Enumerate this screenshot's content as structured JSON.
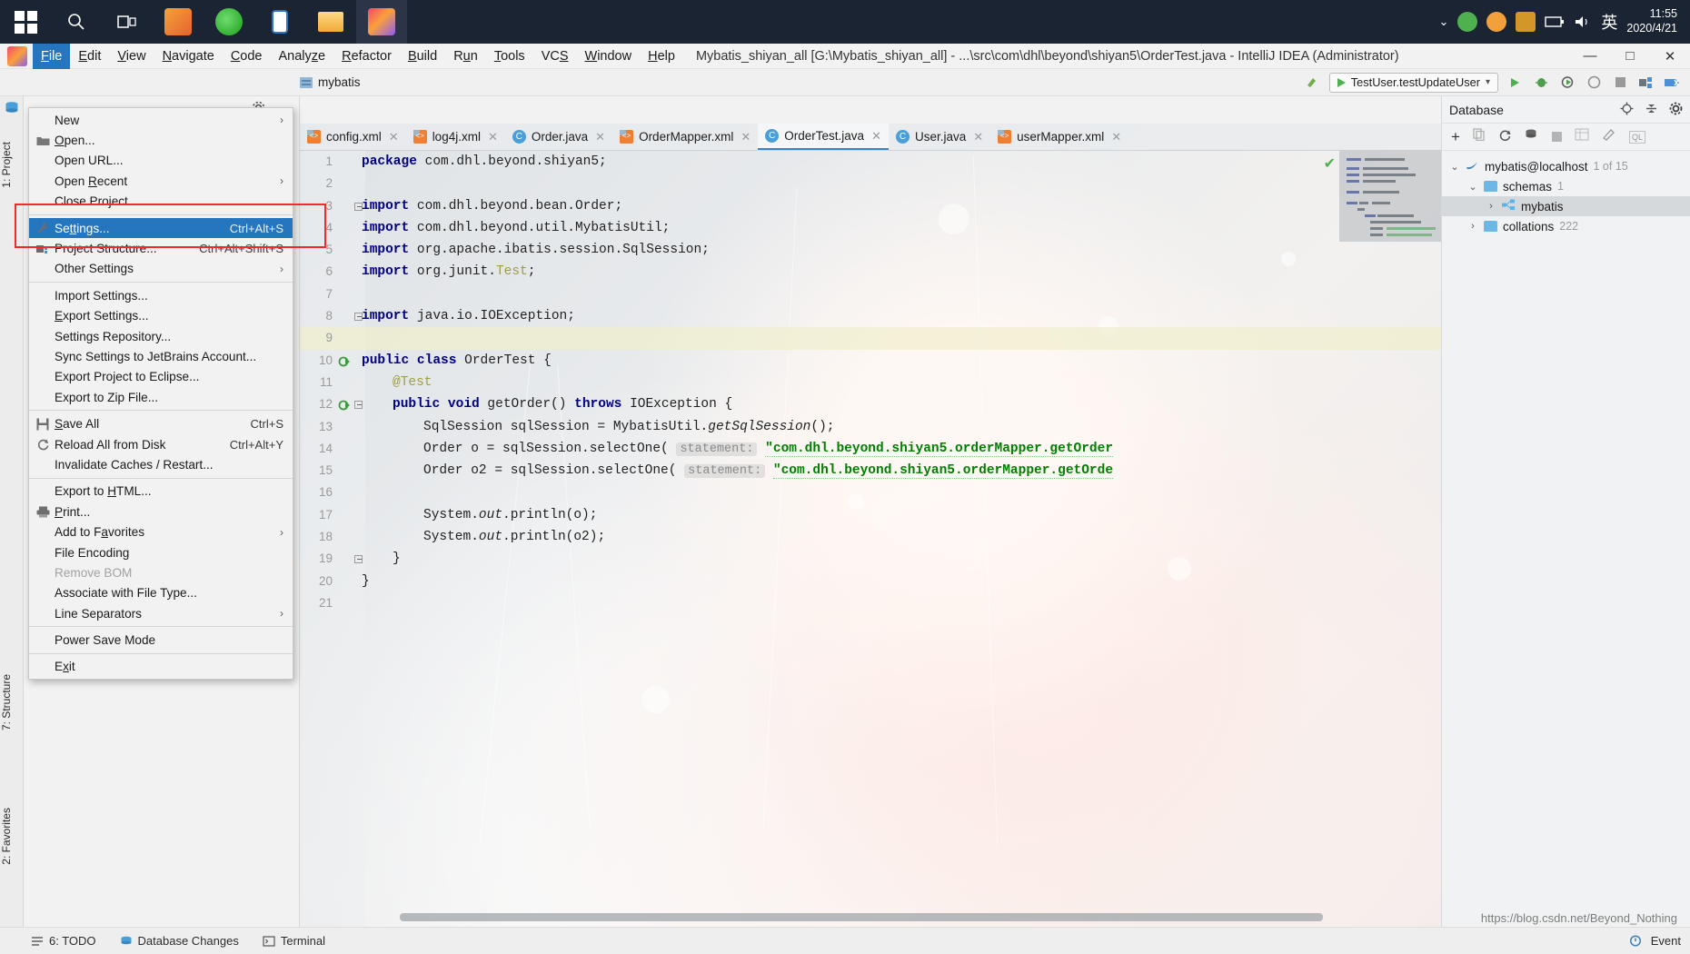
{
  "taskbar": {
    "start_icon": "windows-start-icon",
    "items": [
      {
        "name": "search-icon",
        "glyph": "search"
      },
      {
        "name": "task-view-icon",
        "glyph": "taskview"
      },
      {
        "name": "app-paint-icon",
        "glyph": "paint"
      },
      {
        "name": "app-browser-icon",
        "glyph": "browser"
      },
      {
        "name": "app-phone-icon",
        "glyph": "phone"
      },
      {
        "name": "app-explorer-icon",
        "glyph": "explorer"
      },
      {
        "name": "app-intellij-icon",
        "glyph": "intellij"
      }
    ],
    "tray": {
      "chevron": "⌄",
      "ime_label": "英",
      "time": "11:55",
      "date": "2020/4/21"
    }
  },
  "menubar": {
    "logo": "intellij-idea-logo",
    "items": [
      {
        "label": "File",
        "accel": "F",
        "selected": true
      },
      {
        "label": "Edit",
        "accel": "E",
        "selected": false
      },
      {
        "label": "View",
        "accel": "V",
        "selected": false
      },
      {
        "label": "Navigate",
        "accel": "N",
        "selected": false
      },
      {
        "label": "Code",
        "accel": "C",
        "selected": false
      },
      {
        "label": "Analyze",
        "accel": "z",
        "selected": false
      },
      {
        "label": "Refactor",
        "accel": "R",
        "selected": false
      },
      {
        "label": "Build",
        "accel": "B",
        "selected": false
      },
      {
        "label": "Run",
        "accel": "u",
        "selected": false
      },
      {
        "label": "Tools",
        "accel": "T",
        "selected": false
      },
      {
        "label": "VCS",
        "accel": "S",
        "selected": false
      },
      {
        "label": "Window",
        "accel": "W",
        "selected": false
      },
      {
        "label": "Help",
        "accel": "H",
        "selected": false
      }
    ],
    "window_title": "Mybatis_shiyan_all [G:\\Mybatis_shiyan_all] - ...\\src\\com\\dhl\\beyond\\shiyan5\\OrderTest.java - IntelliJ IDEA (Administrator)",
    "minimize": "—",
    "maximize": "□",
    "close": "✕"
  },
  "file_menu": {
    "groups": [
      [
        {
          "label": "New",
          "key": "",
          "icon": "",
          "arrow": true,
          "state": "normal"
        },
        {
          "label": "Open...",
          "key": "",
          "icon": "folder-icon",
          "arrow": false,
          "state": "normal",
          "accel": "O"
        },
        {
          "label": "Open URL...",
          "key": "",
          "icon": "",
          "arrow": false,
          "state": "normal"
        },
        {
          "label": "Open Recent",
          "key": "",
          "icon": "",
          "arrow": true,
          "state": "normal",
          "accel": "R"
        },
        {
          "label": "Close Project",
          "key": "",
          "icon": "",
          "arrow": false,
          "state": "normal"
        }
      ],
      [
        {
          "label": "Settings...",
          "key": "Ctrl+Alt+S",
          "icon": "wrench-icon",
          "arrow": false,
          "state": "selected",
          "accel": "tt"
        },
        {
          "label": "Project Structure...",
          "key": "Ctrl+Alt+Shift+S",
          "icon": "project-structure-icon",
          "arrow": false,
          "state": "normal"
        },
        {
          "label": "Other Settings",
          "key": "",
          "icon": "",
          "arrow": true,
          "state": "normal"
        }
      ],
      [
        {
          "label": "Import Settings...",
          "key": "",
          "icon": "",
          "arrow": false,
          "state": "normal"
        },
        {
          "label": "Export Settings...",
          "key": "",
          "icon": "",
          "arrow": false,
          "state": "normal",
          "accel": "E"
        },
        {
          "label": "Settings Repository...",
          "key": "",
          "icon": "",
          "arrow": false,
          "state": "normal"
        },
        {
          "label": "Sync Settings to JetBrains Account...",
          "key": "",
          "icon": "",
          "arrow": false,
          "state": "normal"
        },
        {
          "label": "Export Project to Eclipse...",
          "key": "",
          "icon": "",
          "arrow": false,
          "state": "normal"
        },
        {
          "label": "Export to Zip File...",
          "key": "",
          "icon": "",
          "arrow": false,
          "state": "normal"
        }
      ],
      [
        {
          "label": "Save All",
          "key": "Ctrl+S",
          "icon": "save-icon",
          "arrow": false,
          "state": "normal",
          "accel": "S"
        },
        {
          "label": "Reload All from Disk",
          "key": "Ctrl+Alt+Y",
          "icon": "reload-icon",
          "arrow": false,
          "state": "normal"
        },
        {
          "label": "Invalidate Caches / Restart...",
          "key": "",
          "icon": "",
          "arrow": false,
          "state": "normal"
        }
      ],
      [
        {
          "label": "Export to HTML...",
          "key": "",
          "icon": "",
          "arrow": false,
          "state": "normal",
          "accel": "H"
        },
        {
          "label": "Print...",
          "key": "",
          "icon": "printer-icon",
          "arrow": false,
          "state": "normal",
          "accel": "P"
        },
        {
          "label": "Add to Favorites",
          "key": "",
          "icon": "",
          "arrow": true,
          "state": "normal",
          "accel": "a"
        },
        {
          "label": "File Encoding",
          "key": "",
          "icon": "",
          "arrow": false,
          "state": "normal"
        },
        {
          "label": "Remove BOM",
          "key": "",
          "icon": "",
          "arrow": false,
          "state": "disabled"
        },
        {
          "label": "Associate with File Type...",
          "key": "",
          "icon": "",
          "arrow": false,
          "state": "normal"
        },
        {
          "label": "Line Separators",
          "key": "",
          "icon": "",
          "arrow": true,
          "state": "normal"
        }
      ],
      [
        {
          "label": "Power Save Mode",
          "key": "",
          "icon": "",
          "arrow": false,
          "state": "normal"
        }
      ],
      [
        {
          "label": "Exit",
          "key": "",
          "icon": "",
          "arrow": false,
          "state": "normal",
          "accel": "x"
        }
      ]
    ]
  },
  "navbar": {
    "breadcrumb": "mybatis",
    "run_config": "TestUser.testUpdateUser",
    "icons": [
      "run-icon",
      "debug-icon",
      "coverage-icon",
      "profile-icon",
      "stop-icon",
      "build-icon",
      "search-everywhere-icon"
    ]
  },
  "left_strip": {
    "tabs": [
      "1: Project",
      "7: Structure",
      "2: Favorites"
    ],
    "database_icon": "database-icon"
  },
  "editor": {
    "tabs": [
      {
        "label": "config.xml",
        "icon": "xml-file-icon",
        "active": false
      },
      {
        "label": "log4j.xml",
        "icon": "xml-file-icon",
        "active": false
      },
      {
        "label": "Order.java",
        "icon": "java-class-icon",
        "active": false
      },
      {
        "label": "OrderMapper.xml",
        "icon": "xml-file-icon",
        "active": false
      },
      {
        "label": "OrderTest.java",
        "icon": "java-test-icon",
        "active": true
      },
      {
        "label": "User.java",
        "icon": "java-class-icon",
        "active": false
      },
      {
        "label": "userMapper.xml",
        "icon": "xml-file-icon",
        "active": false
      }
    ],
    "close_glyph": "✕",
    "lines": [
      {
        "n": "1",
        "segments": [
          {
            "t": "package ",
            "c": "kw"
          },
          {
            "t": "com.dhl.beyond.shiyan5;",
            "c": ""
          }
        ],
        "indent": 0
      },
      {
        "n": "2",
        "segments": [],
        "indent": 0
      },
      {
        "n": "3",
        "segments": [
          {
            "t": "import ",
            "c": "kw"
          },
          {
            "t": "com.dhl.beyond.bean.Order;",
            "c": ""
          }
        ],
        "indent": 0,
        "fold": true
      },
      {
        "n": "4",
        "segments": [
          {
            "t": "import ",
            "c": "kw"
          },
          {
            "t": "com.dhl.beyond.util.MybatisUtil;",
            "c": ""
          }
        ],
        "indent": 0
      },
      {
        "n": "5",
        "segments": [
          {
            "t": "import ",
            "c": "kw"
          },
          {
            "t": "org.apache.ibatis.session.SqlSession;",
            "c": ""
          }
        ],
        "indent": 0
      },
      {
        "n": "6",
        "segments": [
          {
            "t": "import ",
            "c": "kw"
          },
          {
            "t": "org.junit.",
            "c": ""
          },
          {
            "t": "Test",
            "c": "ann"
          },
          {
            "t": ";",
            "c": ""
          }
        ],
        "indent": 0
      },
      {
        "n": "7",
        "segments": [],
        "indent": 0
      },
      {
        "n": "8",
        "segments": [
          {
            "t": "import ",
            "c": "kw"
          },
          {
            "t": "java.io.IOException;",
            "c": ""
          }
        ],
        "indent": 0,
        "fold": true
      },
      {
        "n": "9",
        "segments": [],
        "indent": 0,
        "highlight": true
      },
      {
        "n": "10",
        "segments": [
          {
            "t": "public class ",
            "c": "kw"
          },
          {
            "t": "OrderTest {",
            "c": ""
          }
        ],
        "indent": 0,
        "run": true
      },
      {
        "n": "11",
        "segments": [
          {
            "t": "@Test",
            "c": "ann"
          }
        ],
        "indent": 1
      },
      {
        "n": "12",
        "segments": [
          {
            "t": "public void ",
            "c": "kw"
          },
          {
            "t": "getOrder() ",
            "c": ""
          },
          {
            "t": "throws ",
            "c": "kw"
          },
          {
            "t": "IOException {",
            "c": ""
          }
        ],
        "indent": 1,
        "run": true,
        "fold": true
      },
      {
        "n": "13",
        "segments": [
          {
            "t": "SqlSession sqlSession = MybatisUtil.",
            "c": ""
          },
          {
            "t": "getSqlSession",
            "c": "itl"
          },
          {
            "t": "();",
            "c": ""
          }
        ],
        "indent": 2
      },
      {
        "n": "14",
        "segments": [
          {
            "t": "Order o = sqlSession.selectOne( ",
            "c": ""
          },
          {
            "t": "statement:",
            "c": "hint"
          },
          {
            "t": " ",
            "c": ""
          },
          {
            "t": "\"com.dhl.beyond.shiyan5.orderMapper.getOrder",
            "c": "str"
          }
        ],
        "indent": 2
      },
      {
        "n": "15",
        "segments": [
          {
            "t": "Order o2 = sqlSession.selectOne( ",
            "c": ""
          },
          {
            "t": "statement:",
            "c": "hint"
          },
          {
            "t": " ",
            "c": ""
          },
          {
            "t": "\"com.dhl.beyond.shiyan5.orderMapper.getOrde",
            "c": "str"
          }
        ],
        "indent": 2
      },
      {
        "n": "16",
        "segments": [],
        "indent": 0
      },
      {
        "n": "17",
        "segments": [
          {
            "t": "System.",
            "c": ""
          },
          {
            "t": "out",
            "c": "itl"
          },
          {
            "t": ".println(o);",
            "c": ""
          }
        ],
        "indent": 2
      },
      {
        "n": "18",
        "segments": [
          {
            "t": "System.",
            "c": ""
          },
          {
            "t": "out",
            "c": "itl"
          },
          {
            "t": ".println(o2);",
            "c": ""
          }
        ],
        "indent": 2
      },
      {
        "n": "19",
        "segments": [
          {
            "t": "}",
            "c": ""
          }
        ],
        "indent": 1,
        "fold": true
      },
      {
        "n": "20",
        "segments": [
          {
            "t": "}",
            "c": ""
          }
        ],
        "indent": 0
      },
      {
        "n": "21",
        "segments": [],
        "indent": 0
      }
    ],
    "inspection_ok": "✔"
  },
  "database": {
    "title": "Database",
    "header_icons": [
      "locate-icon",
      "collapse-all-icon",
      "gear-icon"
    ],
    "toolbar_icons": [
      "add-icon",
      "copy-icon",
      "refresh-icon",
      "filter-icon",
      "stop-icon",
      "table-icon",
      "edit-icon",
      "console-icon"
    ],
    "tree": [
      {
        "label": "mybatis@localhost",
        "badge": "1 of 15",
        "depth": 0,
        "expanded": true,
        "icon": "mysql-icon",
        "selected": false
      },
      {
        "label": "schemas",
        "badge": "1",
        "depth": 1,
        "expanded": true,
        "icon": "folder-icon",
        "selected": false
      },
      {
        "label": "mybatis",
        "badge": "",
        "depth": 2,
        "expanded": false,
        "icon": "schema-icon",
        "selected": true
      },
      {
        "label": "collations",
        "badge": "222",
        "depth": 1,
        "expanded": false,
        "icon": "folder-icon",
        "selected": false
      }
    ]
  },
  "statusbar": {
    "items": [
      {
        "label": "6: TODO",
        "icon": "todo-icon"
      },
      {
        "label": "Database Changes",
        "icon": "db-changes-icon"
      },
      {
        "label": "Terminal",
        "icon": "terminal-icon"
      }
    ],
    "event_log": "Event",
    "watermark": "https://blog.csdn.net/Beyond_Nothing"
  },
  "colors": {
    "accent_blue": "#2675bf",
    "annotation_red": "#f32a2a",
    "keyword": "#000080",
    "string": "#008000",
    "taskbar_bg": "#1b2433"
  }
}
